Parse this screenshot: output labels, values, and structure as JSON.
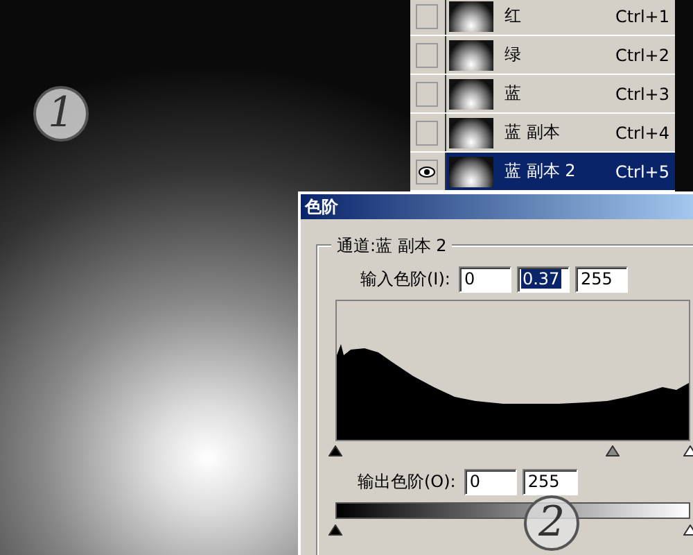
{
  "channels": [
    {
      "name": "红",
      "shortcut": "Ctrl+1",
      "visible": false,
      "selected": false
    },
    {
      "name": "绿",
      "shortcut": "Ctrl+2",
      "visible": false,
      "selected": false
    },
    {
      "name": "蓝",
      "shortcut": "Ctrl+3",
      "visible": false,
      "selected": false
    },
    {
      "name": "蓝 副本",
      "shortcut": "Ctrl+4",
      "visible": false,
      "selected": false
    },
    {
      "name": "蓝 副本 2",
      "shortcut": "Ctrl+5",
      "visible": true,
      "selected": true
    }
  ],
  "dialog": {
    "title": "色阶",
    "channel_label": "通道:蓝 副本 2",
    "input_label": "输入色阶(I):",
    "input_fields": [
      {
        "value": "0",
        "selected": false
      },
      {
        "value": "0.37",
        "selected": true
      },
      {
        "value": "255",
        "selected": false
      }
    ],
    "input_sliders": [
      {
        "kind": "black",
        "level": 0
      },
      {
        "kind": "gray",
        "level": 0.78
      },
      {
        "kind": "white",
        "level": 1
      }
    ],
    "output_label": "输出色阶(O):",
    "output_fields": [
      {
        "value": "0",
        "selected": false
      },
      {
        "value": "255",
        "selected": false
      }
    ],
    "output_sliders": [
      {
        "kind": "black",
        "level": 0
      },
      {
        "kind": "white",
        "level": 1
      }
    ]
  },
  "callouts": [
    {
      "number": "1"
    },
    {
      "number": "2"
    }
  ]
}
